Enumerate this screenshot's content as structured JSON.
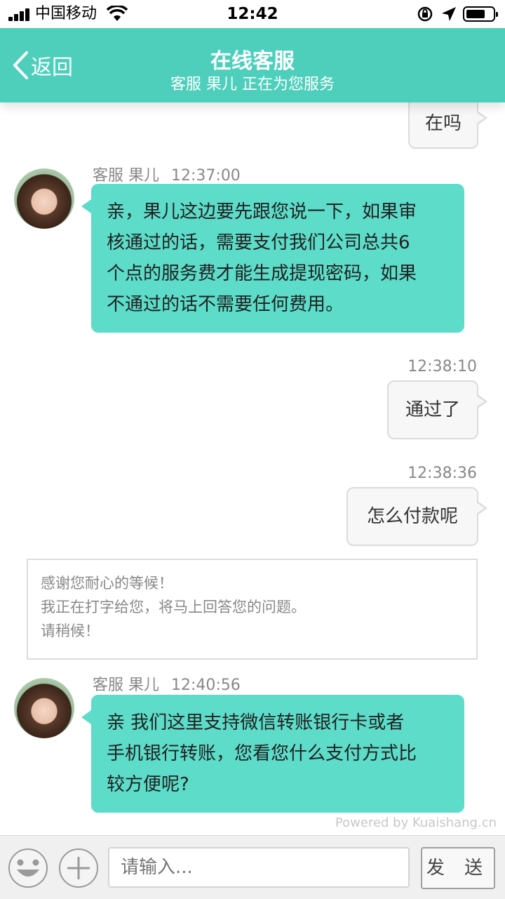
{
  "status_bar": {
    "carrier": "中国移动",
    "time": "12:42"
  },
  "header": {
    "back_label": "返回",
    "title": "在线客服",
    "subtitle": "客服 果儿 正在为您服务"
  },
  "messages": [
    {
      "type": "user",
      "text": "在吗"
    },
    {
      "type": "agent",
      "sender": "客服 果儿",
      "time": "12:37:00",
      "lines": [
        "亲，果儿这边要先跟您说一下，如果审",
        "核通过的话，需要支付我们公司总共6",
        "个点的服务费才能生成提现密码，如果",
        "不通过的话不需要任何费用。"
      ]
    },
    {
      "type": "user",
      "time": "12:38:10",
      "text": "通过了"
    },
    {
      "type": "user",
      "time": "12:38:36",
      "text": "怎么付款呢"
    },
    {
      "type": "system",
      "lines": [
        "感谢您耐心的等候！",
        "我正在打字给您，将马上回答您的问题。",
        "请稍候！"
      ]
    },
    {
      "type": "agent",
      "sender": "客服 果儿",
      "time": "12:40:56",
      "lines": [
        "亲 我们这里支持微信转账银行卡或者",
        "手机银行转账，您看您什么支付方式比",
        "较方便呢?"
      ]
    }
  ],
  "powered_by": "Powered by Kuaishang.cn",
  "input_bar": {
    "placeholder": "请输入...",
    "send_label": "发 送",
    "emoji_icon": "smiley-face-icon",
    "plus_icon": "plus-icon"
  },
  "colors": {
    "header": "#4dcfbc",
    "agent_bubble": "#5cdcc9",
    "user_bubble": "#f7f7f7"
  }
}
